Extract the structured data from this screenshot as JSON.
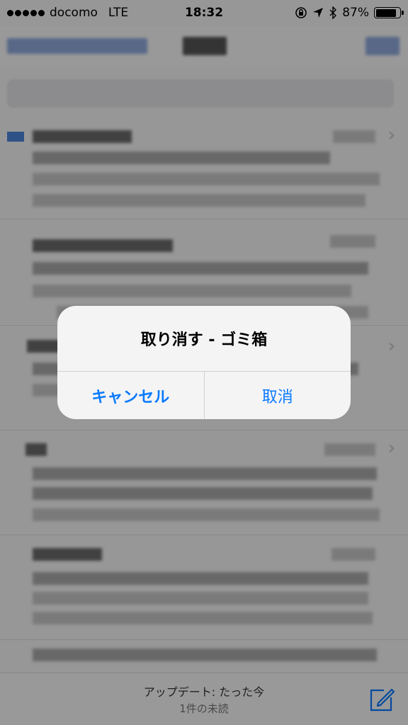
{
  "status_bar": {
    "carrier": "docomo",
    "network": "LTE",
    "time": "18:32",
    "battery": "87%",
    "battery_level": 0.87
  },
  "toolbar": {
    "update_text": "アップデート: たった今",
    "unread_text": "1件の未読"
  },
  "alert": {
    "title": "取り消す - ゴミ箱",
    "cancel_label": "キャンセル",
    "confirm_label": "取消"
  },
  "colors": {
    "accent": "#0a7aff",
    "unread_marker": "#4d85d8"
  },
  "icons": [
    "orientation-lock-icon",
    "location-arrow-icon",
    "bluetooth-icon",
    "battery-icon",
    "compose-icon",
    "chevron-right-icon"
  ]
}
